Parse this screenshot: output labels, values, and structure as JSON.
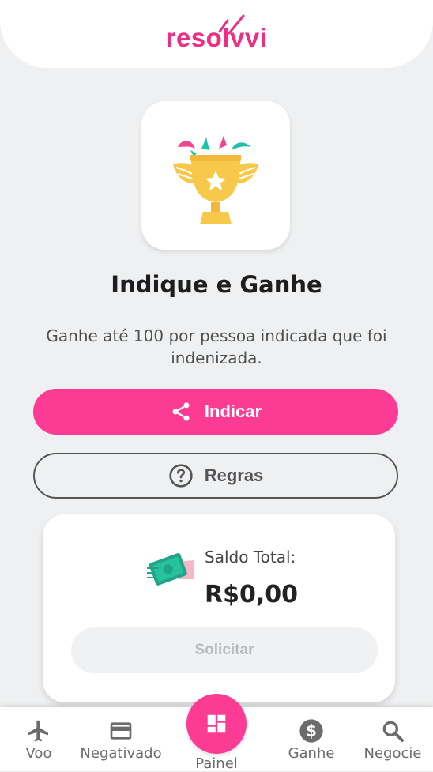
{
  "app": {
    "logo_text": "resolvvi",
    "brand_color": "#fc3b95"
  },
  "hero": {
    "icon": "trophy-icon",
    "title": "Indique e Ganhe",
    "subtitle": "Ganhe até 100 por pessoa indicada que foi indenizada."
  },
  "actions": {
    "indicar_label": "Indicar",
    "indicar_icon": "share-icon",
    "regras_label": "Regras",
    "regras_icon": "help-circle-icon"
  },
  "balance": {
    "icon": "money-hand-icon",
    "label": "Saldo Total:",
    "value": "R$0,00",
    "request_label": "Solicitar"
  },
  "bottom_nav": {
    "items": [
      {
        "label": "Voo",
        "icon": "airplane-icon"
      },
      {
        "label": "Negativado",
        "icon": "credit-card-icon"
      },
      {
        "label": "Painel",
        "icon": "dashboard-icon",
        "active": true
      },
      {
        "label": "Ganhe",
        "icon": "dollar-circle-icon"
      },
      {
        "label": "Negocie",
        "icon": "search-icon"
      }
    ]
  }
}
